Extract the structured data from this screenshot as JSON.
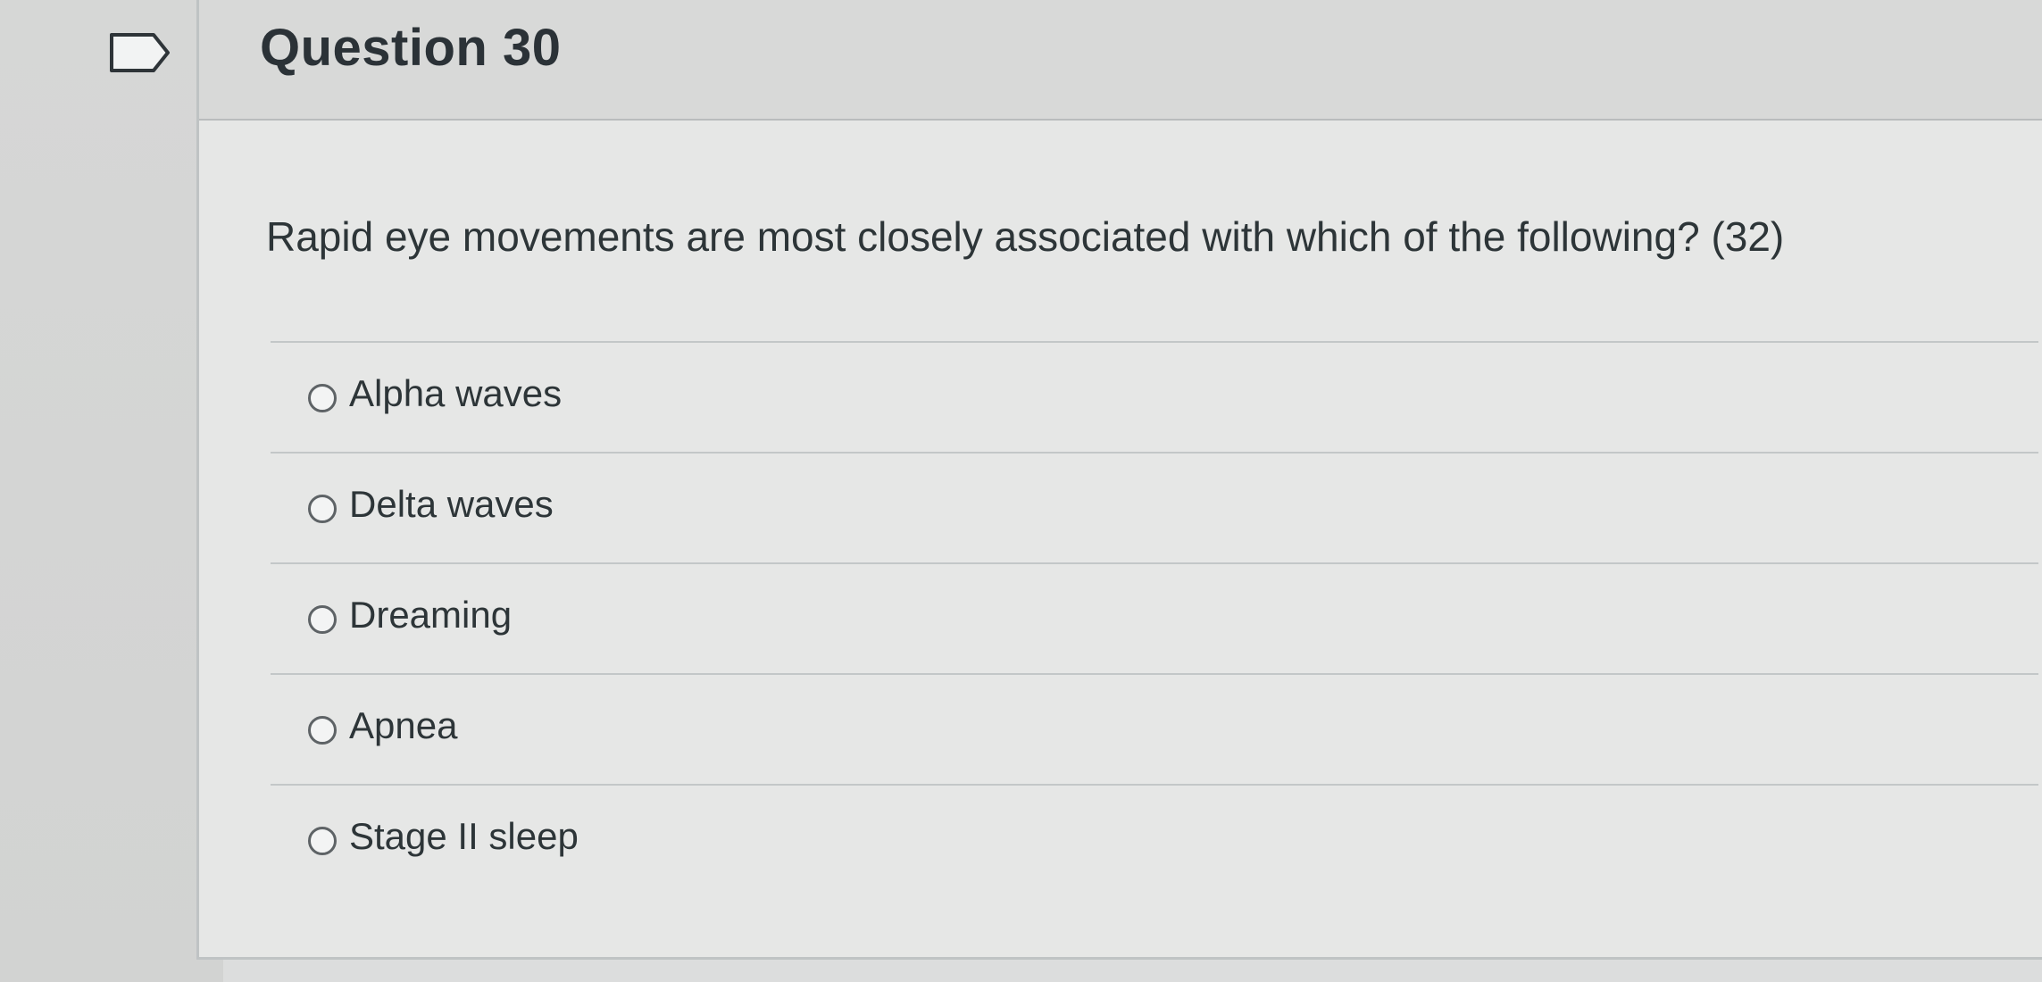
{
  "question": {
    "title": "Question 30",
    "text": "Rapid eye movements are most closely associated with which of the following? (32)",
    "answers": [
      {
        "label": "Alpha waves"
      },
      {
        "label": "Delta waves"
      },
      {
        "label": "Dreaming"
      },
      {
        "label": "Apnea"
      },
      {
        "label": "Stage II sleep"
      }
    ]
  },
  "icons": {
    "flag": "flag-outline-icon",
    "radio": "radio-unselected"
  },
  "colors": {
    "background": "#dcdddd",
    "header": "#d8d9d8",
    "card": "#e6e7e6",
    "text": "#2d3538"
  }
}
